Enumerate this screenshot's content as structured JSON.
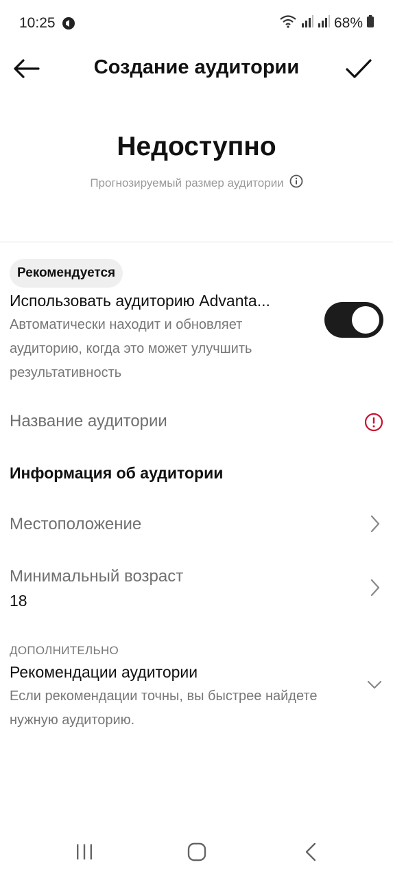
{
  "status_bar": {
    "time": "10:25",
    "battery": "68%"
  },
  "header": {
    "title": "Создание аудитории",
    "back_icon": "arrow-left-icon",
    "confirm_icon": "checkmark-icon"
  },
  "audience_size": {
    "value": "Недоступно",
    "label": "Прогнозируемый размер аудитории"
  },
  "advantage": {
    "badge": "Рекомендуется",
    "title": "Использовать аудиторию Advanta...",
    "description": "Автоматически находит и обновляет аудиторию, когда это может улучшить результативность",
    "toggle_on": true
  },
  "audience_name": {
    "label": "Название аудитории"
  },
  "audience_info": {
    "heading": "Информация об аудитории",
    "location_label": "Местоположение",
    "min_age_label": "Минимальный возраст",
    "min_age_value": "18"
  },
  "advanced": {
    "caption": "ДОПОЛНИТЕЛЬНО",
    "title": "Рекомендации аудитории",
    "description": "Если рекомендации точны, вы быстрее найдете нужную аудиторию."
  },
  "colors": {
    "error": "#c8102e",
    "toggle_on": "#1c1c1c"
  }
}
